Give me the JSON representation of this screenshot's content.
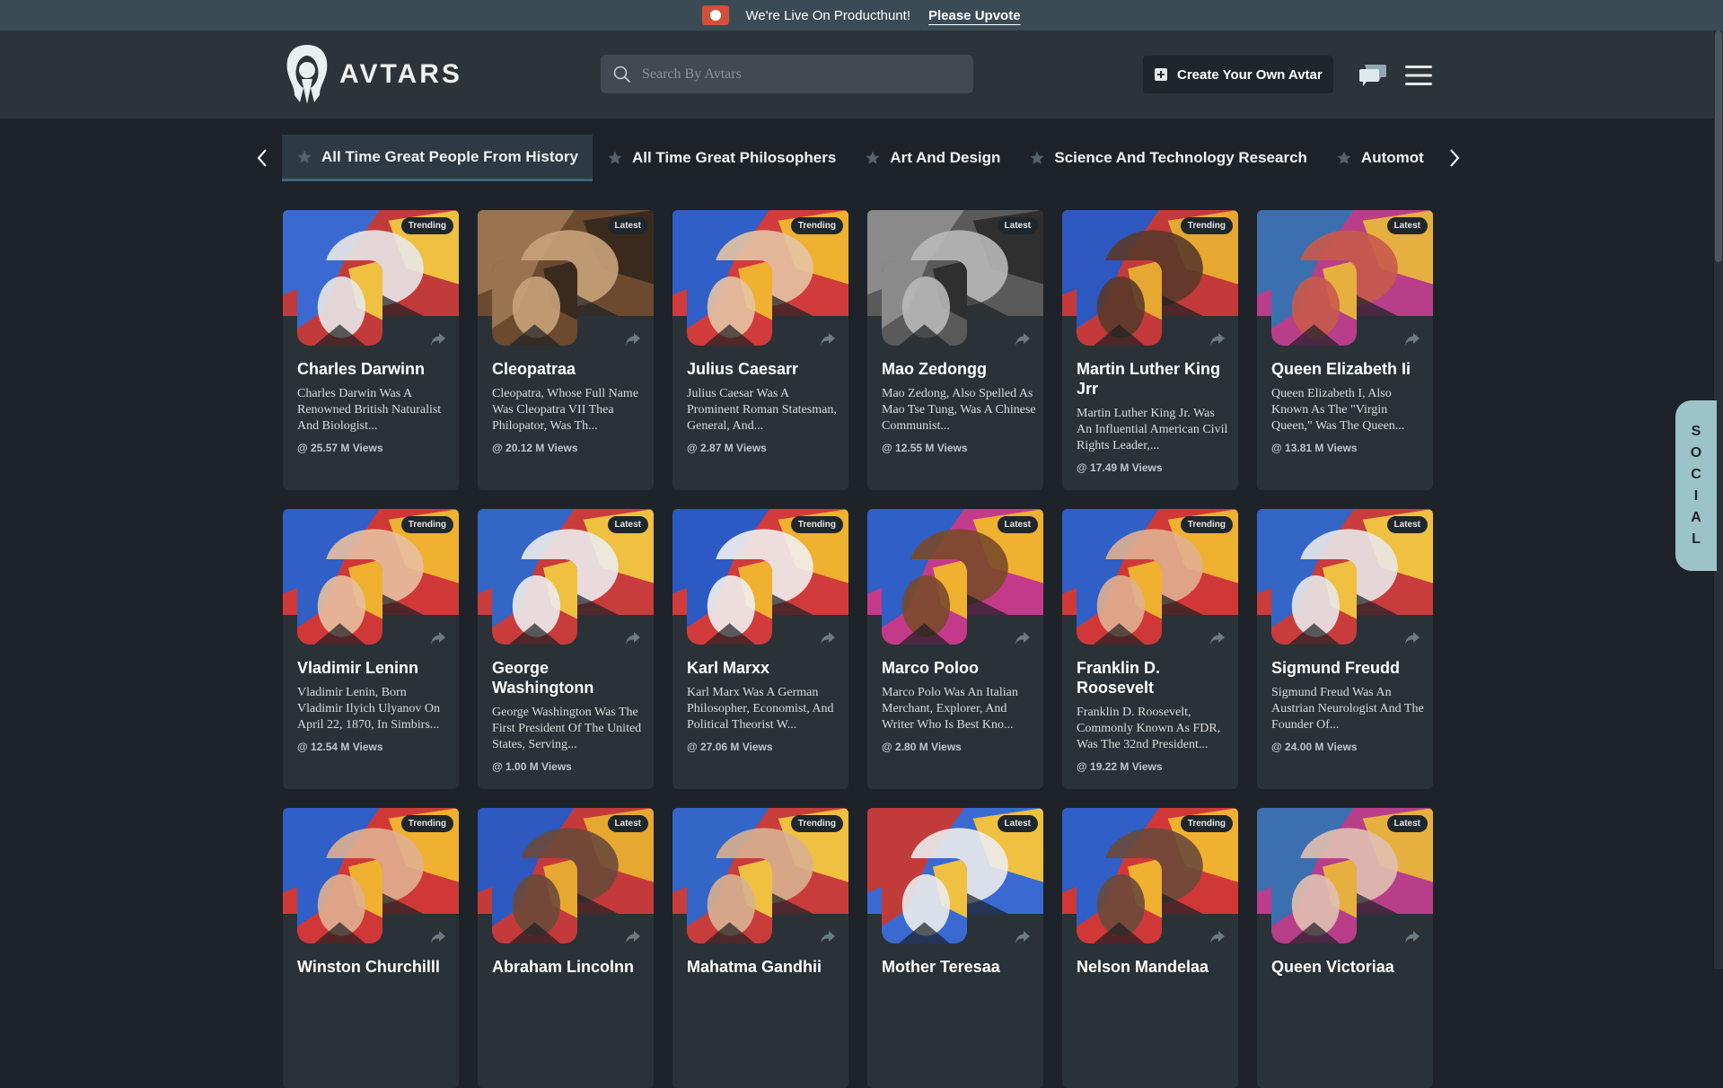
{
  "banner": {
    "text": "We're Live On Producthunt!",
    "link": "Please Upvote"
  },
  "header": {
    "logo_text": "AVTARS",
    "search_placeholder": "Search By Avtars",
    "create_button": "Create Your Own Avtar"
  },
  "tabs": [
    {
      "label": "All Time Great People From History",
      "active": true
    },
    {
      "label": "All Time Great Philosophers"
    },
    {
      "label": "Art And Design"
    },
    {
      "label": "Science And Technology Research"
    },
    {
      "label": "Automot"
    }
  ],
  "social_label": [
    "S",
    "O",
    "C",
    "I",
    "A",
    "L"
  ],
  "cards": [
    {
      "name": "Charles Darwinn",
      "badge": "Trending",
      "desc": "Charles Darwin Was A Renowned British Naturalist And Biologist...",
      "views": "@ 25.57 M Views",
      "colors": [
        "#c23b3b",
        "#3a6ad1",
        "#f0c040",
        "#e8e8e8"
      ]
    },
    {
      "name": "Cleopatraa",
      "badge": "Latest",
      "desc": "Cleopatra, Whose Full Name Was Cleopatra VII Thea Philopator, Was Th...",
      "views": "@ 20.12 M Views",
      "colors": [
        "#6b4a30",
        "#9a7350",
        "#3a2a1e",
        "#c9a27a"
      ]
    },
    {
      "name": "Julius Caesarr",
      "badge": "Trending",
      "desc": "Julius Caesar Was A Prominent Roman Statesman, General, And...",
      "views": "@ 2.87 M Views",
      "colors": [
        "#d13b3b",
        "#2f5fc7",
        "#f0b030",
        "#e4c4a4"
      ]
    },
    {
      "name": "Mao Zedongg",
      "badge": "Latest",
      "desc": "Mao Zedong, Also Spelled As Mao Tse Tung, Was A Chinese Communist...",
      "views": "@ 12.55 M Views",
      "colors": [
        "#5a5a5a",
        "#8a8a8a",
        "#2f2f2f",
        "#b8b8b8"
      ]
    },
    {
      "name": "Martin Luther King Jrr",
      "badge": "Trending",
      "desc": "Martin Luther King Jr. Was An Influential American Civil Rights Leader,...",
      "views": "@ 17.49 M Views",
      "colors": [
        "#c43a3a",
        "#2d58c0",
        "#e6a830",
        "#5a3a2a"
      ]
    },
    {
      "name": "Queen Elizabeth Ii",
      "badge": "Latest",
      "desc": "Queen Elizabeth I, Also Known As The \"Virgin Queen,\" Was The Queen...",
      "views": "@ 13.81 M Views",
      "colors": [
        "#b83e8a",
        "#3c6fb0",
        "#e6b040",
        "#c85a4a"
      ]
    },
    {
      "name": "Vladimir Leninn",
      "badge": "Trending",
      "desc": "Vladimir Lenin, Born Vladimir Ilyich Ulyanov On April 22, 1870, In Simbirs...",
      "views": "@ 12.54 M Views",
      "colors": [
        "#d03838",
        "#2f5fc7",
        "#f0b030",
        "#e8c0a0"
      ]
    },
    {
      "name": "George Washingtonn",
      "badge": "Latest",
      "desc": "George Washington Was The First President Of The United States, Serving...",
      "views": "@ 1.00 M Views",
      "colors": [
        "#c83c3c",
        "#3466c8",
        "#f0c040",
        "#ececec"
      ]
    },
    {
      "name": "Karl Marxx",
      "badge": "Trending",
      "desc": "Karl Marx Was A German Philosopher, Economist, And Political Theorist W...",
      "views": "@ 27.06 M Views",
      "colors": [
        "#d13b3b",
        "#2c5ac4",
        "#f0b030",
        "#f0f0f0"
      ]
    },
    {
      "name": "Marco Poloo",
      "badge": "Latest",
      "desc": "Marco Polo Was An Italian Merchant, Explorer, And Writer Who Is Best Kno...",
      "views": "@ 2.80 M Views",
      "colors": [
        "#c43a8a",
        "#2f5fc7",
        "#f0b030",
        "#7a4a2a"
      ]
    },
    {
      "name": "Franklin D. Roosevelt",
      "badge": "Trending",
      "desc": "Franklin D. Roosevelt, Commonly Known As FDR, Was The 32nd President...",
      "views": "@ 19.22 M Views",
      "colors": [
        "#d03838",
        "#2f5fc7",
        "#f0b030",
        "#e0b090"
      ]
    },
    {
      "name": "Sigmund Freudd",
      "badge": "Latest",
      "desc": "Sigmund Freud Was An Austrian Neurologist And The Founder Of...",
      "views": "@ 24.00 M Views",
      "colors": [
        "#c83c3c",
        "#3466c8",
        "#f0c040",
        "#e8e8e8"
      ]
    },
    {
      "name": "Winston Churchilll",
      "badge": "Trending",
      "desc": "",
      "views": "",
      "colors": [
        "#d03838",
        "#2f5fc7",
        "#f0b030",
        "#e0b090"
      ]
    },
    {
      "name": "Abraham Lincolnn",
      "badge": "Latest",
      "desc": "",
      "views": "",
      "colors": [
        "#c43a3a",
        "#2d58c0",
        "#e6a830",
        "#6a4a3a"
      ]
    },
    {
      "name": "Mahatma Gandhii",
      "badge": "Trending",
      "desc": "",
      "views": "",
      "colors": [
        "#c83c3c",
        "#3466c8",
        "#f0c040",
        "#d8b090"
      ]
    },
    {
      "name": "Mother Teresaa",
      "badge": "Latest",
      "desc": "",
      "views": "",
      "colors": [
        "#3a6ad1",
        "#c23b3b",
        "#f0c040",
        "#ececec"
      ]
    },
    {
      "name": "Nelson Mandelaa",
      "badge": "Trending",
      "desc": "",
      "views": "",
      "colors": [
        "#d03838",
        "#2f5fc7",
        "#f0b030",
        "#6a4a3a"
      ]
    },
    {
      "name": "Queen Victoriaa",
      "badge": "Latest",
      "desc": "",
      "views": "",
      "colors": [
        "#b83e8a",
        "#3c6fb0",
        "#e6b040",
        "#e0c0b0"
      ]
    }
  ]
}
